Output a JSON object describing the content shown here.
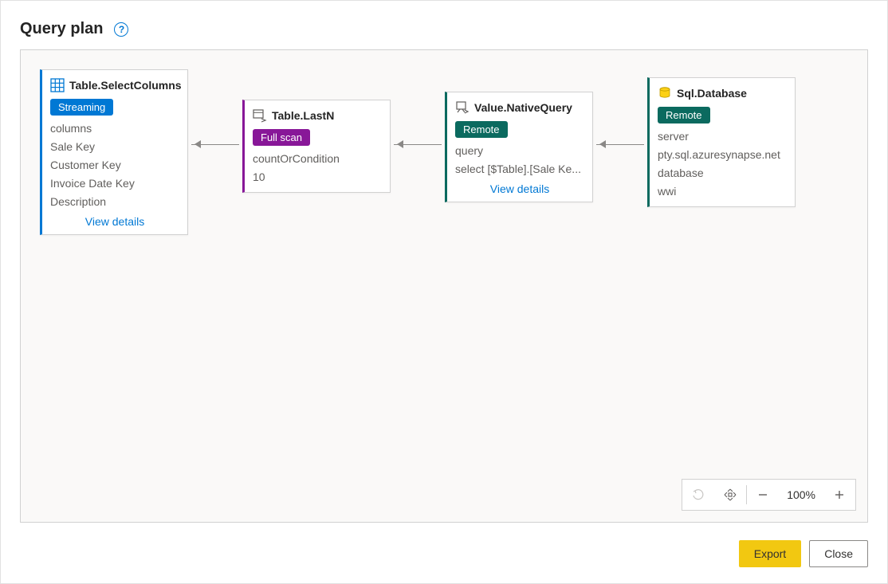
{
  "header": {
    "title": "Query plan"
  },
  "nodes": {
    "selectColumns": {
      "title": "Table.SelectColumns",
      "badge": "Streaming",
      "rows": [
        "columns",
        "Sale Key",
        "Customer Key",
        "Invoice Date Key",
        "Description"
      ],
      "viewDetails": "View details"
    },
    "lastN": {
      "title": "Table.LastN",
      "badge": "Full scan",
      "rows": [
        "countOrCondition",
        "10"
      ]
    },
    "nativeQuery": {
      "title": "Value.NativeQuery",
      "badge": "Remote",
      "rows": [
        "query",
        "select [$Table].[Sale Ke..."
      ],
      "viewDetails": "View details"
    },
    "sqlDatabase": {
      "title": "Sql.Database",
      "badge": "Remote",
      "rows": [
        "server",
        "pty.sql.azuresynapse.net",
        "database",
        "wwi"
      ]
    }
  },
  "zoom": {
    "value": "100%"
  },
  "footer": {
    "export": "Export",
    "close": "Close"
  }
}
